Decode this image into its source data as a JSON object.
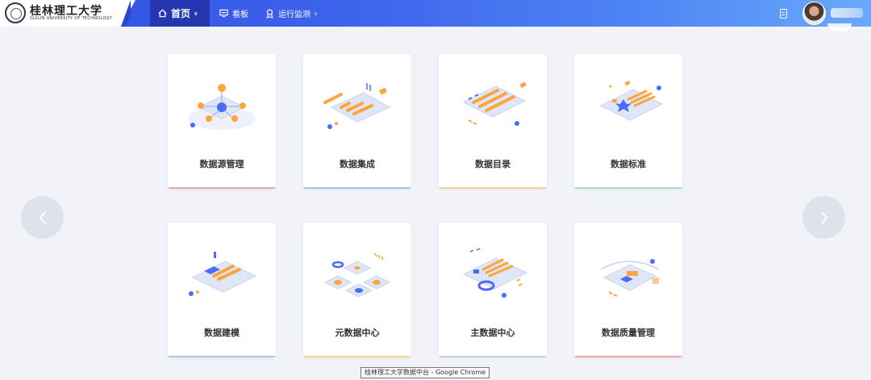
{
  "header": {
    "logo_cn": "桂林理工大学",
    "logo_en": "GUILIN UNIVERSITY OF TECHNOLOGY",
    "nav": [
      {
        "label": "首页",
        "icon": "home-icon",
        "active": true,
        "has_dropdown": true
      },
      {
        "label": "看板",
        "icon": "board-icon",
        "active": false,
        "has_dropdown": false
      },
      {
        "label": "运行监测",
        "icon": "monitor-icon",
        "active": false,
        "has_dropdown": true
      }
    ],
    "colors": {
      "bar_start": "#2f4fe0",
      "bar_end": "#6aa9fb",
      "active_tab": "#2437b0"
    }
  },
  "cards": [
    {
      "title": "数据源管理",
      "accent": "#f0a3a3"
    },
    {
      "title": "数据集成",
      "accent": "#9fc0f0"
    },
    {
      "title": "数据目录",
      "accent": "#f5d48a"
    },
    {
      "title": "数据标准",
      "accent": "#9fdcc9"
    },
    {
      "title": "数据建模",
      "accent": "#aac4ee"
    },
    {
      "title": "元数据中心",
      "accent": "#f5d48a"
    },
    {
      "title": "主数据中心",
      "accent": "#c2cde6"
    },
    {
      "title": "数据质量管理",
      "accent": "#f0a3a3"
    }
  ],
  "colors": {
    "illus_blue": "#4a6cf7",
    "illus_orange": "#ffa53b",
    "illus_light": "#dfe6f7"
  },
  "tooltip": "桂林理工大学数据中台 - Google Chrome"
}
